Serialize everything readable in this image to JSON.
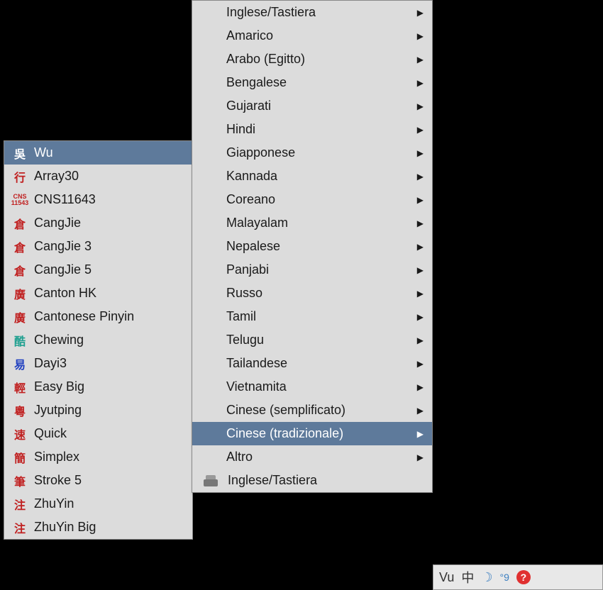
{
  "leftMenu": {
    "items": [
      {
        "icon": "吳",
        "iconClass": "red",
        "label": "Wu",
        "selected": true
      },
      {
        "icon": "行",
        "iconClass": "red",
        "label": "Array30"
      },
      {
        "icon": "CNS\n11543",
        "iconClass": "cns",
        "label": "CNS11643"
      },
      {
        "icon": "倉",
        "iconClass": "red",
        "label": "CangJie"
      },
      {
        "icon": "倉",
        "iconClass": "red",
        "label": "CangJie 3"
      },
      {
        "icon": "倉",
        "iconClass": "red",
        "label": "CangJie 5"
      },
      {
        "icon": "廣",
        "iconClass": "red",
        "label": "Canton HK"
      },
      {
        "icon": "廣",
        "iconClass": "red",
        "label": "Cantonese Pinyin"
      },
      {
        "icon": "酷",
        "iconClass": "teal",
        "label": "Chewing"
      },
      {
        "icon": "易",
        "iconClass": "blue",
        "label": "Dayi3"
      },
      {
        "icon": "輕",
        "iconClass": "red",
        "label": "Easy Big"
      },
      {
        "icon": "粵",
        "iconClass": "red",
        "label": "Jyutping"
      },
      {
        "icon": "速",
        "iconClass": "red",
        "label": "Quick"
      },
      {
        "icon": "簡",
        "iconClass": "red",
        "label": "Simplex"
      },
      {
        "icon": "筆",
        "iconClass": "red",
        "label": "Stroke 5"
      },
      {
        "icon": "注",
        "iconClass": "red",
        "label": "ZhuYin"
      },
      {
        "icon": "注",
        "iconClass": "red",
        "label": "ZhuYin Big"
      }
    ]
  },
  "rightMenu": {
    "items": [
      {
        "label": "Inglese/Tastiera",
        "hasArrow": true
      },
      {
        "label": "Amarico",
        "hasArrow": true
      },
      {
        "label": "Arabo (Egitto)",
        "hasArrow": true
      },
      {
        "label": "Bengalese",
        "hasArrow": true
      },
      {
        "label": "Gujarati",
        "hasArrow": true
      },
      {
        "label": "Hindi",
        "hasArrow": true
      },
      {
        "label": "Giapponese",
        "hasArrow": true
      },
      {
        "label": "Kannada",
        "hasArrow": true
      },
      {
        "label": "Coreano",
        "hasArrow": true
      },
      {
        "label": "Malayalam",
        "hasArrow": true
      },
      {
        "label": "Nepalese",
        "hasArrow": true
      },
      {
        "label": "Panjabi",
        "hasArrow": true
      },
      {
        "label": "Russo",
        "hasArrow": true
      },
      {
        "label": "Tamil",
        "hasArrow": true
      },
      {
        "label": "Telugu",
        "hasArrow": true
      },
      {
        "label": "Tailandese",
        "hasArrow": true
      },
      {
        "label": "Vietnamita",
        "hasArrow": true
      },
      {
        "label": "Cinese (semplificato)",
        "hasArrow": true
      },
      {
        "label": "Cinese (tradizionale)",
        "hasArrow": true,
        "selected": true
      },
      {
        "label": "Altro",
        "hasArrow": true
      },
      {
        "label": "Inglese/Tastiera",
        "hasIcon": true,
        "iconType": "printer"
      }
    ]
  },
  "taskbar": {
    "label": "Vu",
    "zhChar": "中",
    "moonChar": "☽",
    "toggleText": "°9",
    "helpChar": "?"
  }
}
